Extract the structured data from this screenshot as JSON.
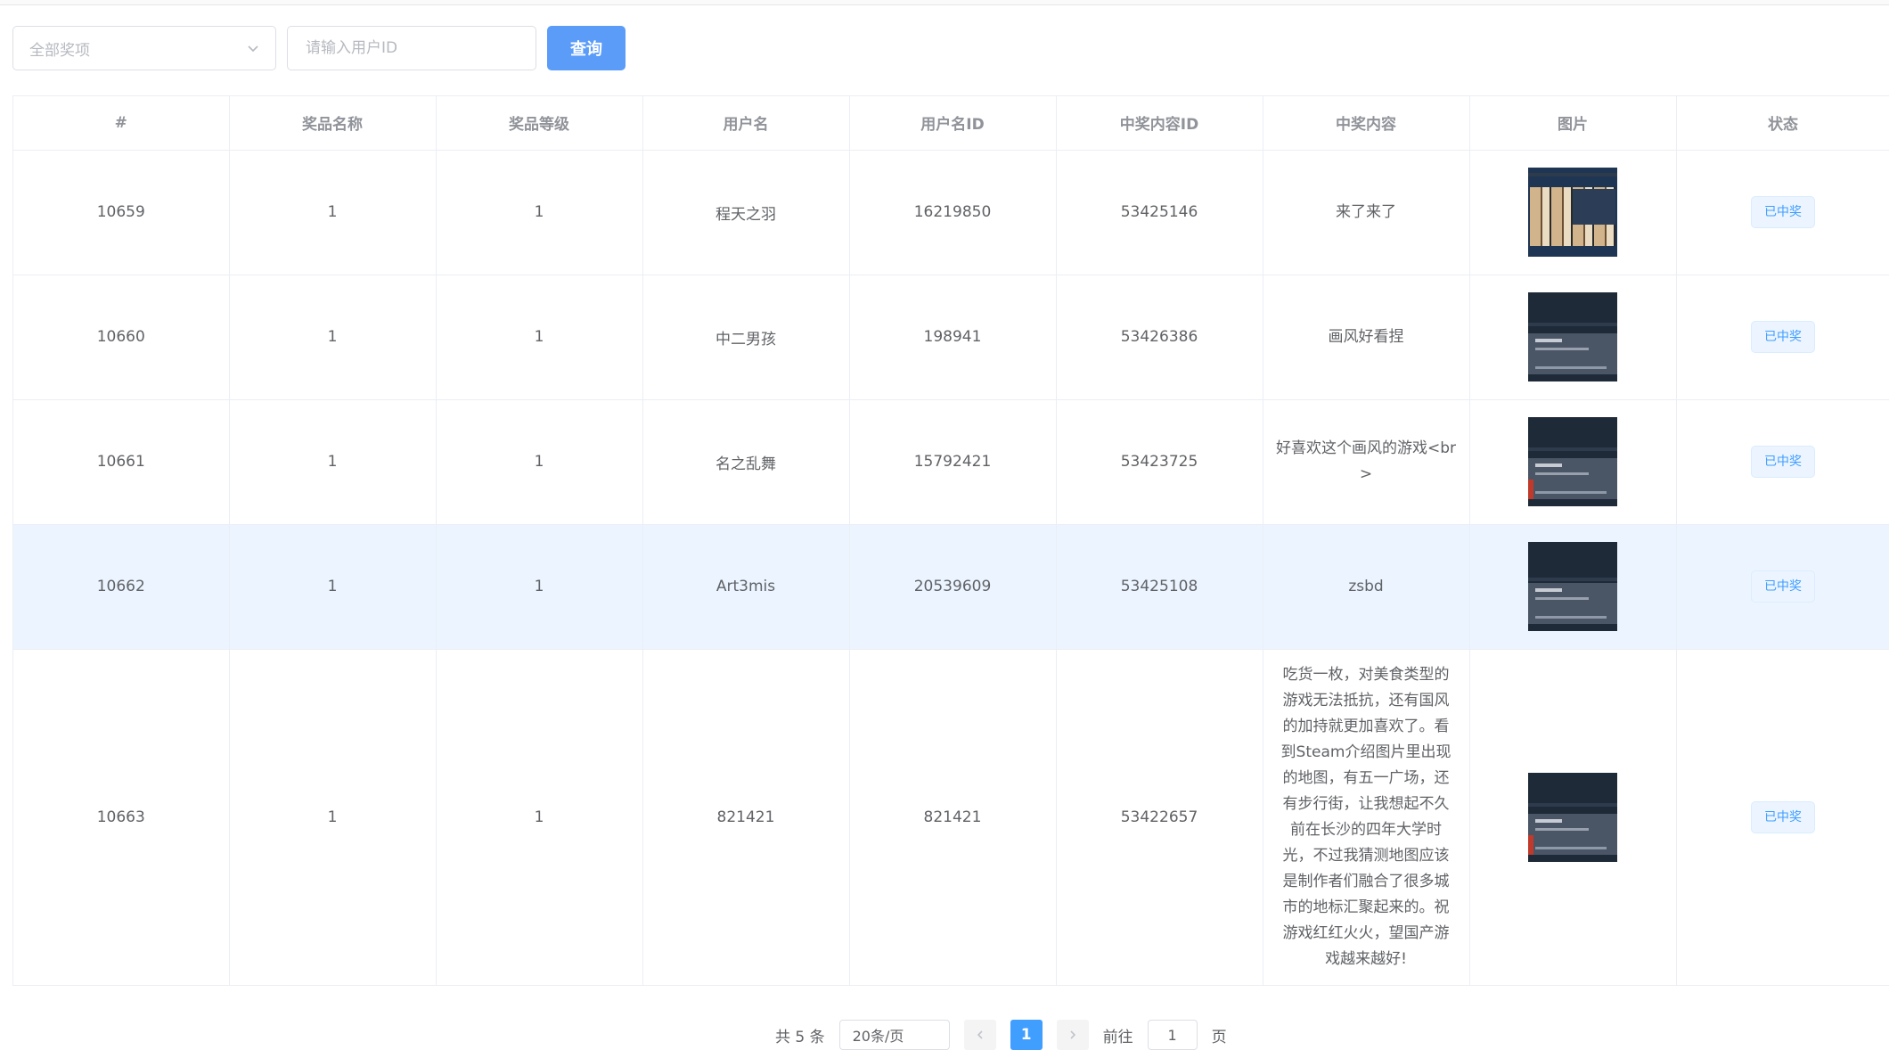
{
  "filters": {
    "prize_select_value": "全部奖项",
    "user_id_placeholder": "请输入用户ID",
    "query_button": "查询"
  },
  "table": {
    "headers": [
      "#",
      "奖品名称",
      "奖品等级",
      "用户名",
      "用户名ID",
      "中奖内容ID",
      "中奖内容",
      "图片",
      "状态"
    ],
    "rows": [
      {
        "id": "10659",
        "prize_name": "1",
        "prize_level": "1",
        "username": "程天之羽",
        "user_id": "16219850",
        "content_id": "53425146",
        "content": "来了来了",
        "status": "已中奖"
      },
      {
        "id": "10660",
        "prize_name": "1",
        "prize_level": "1",
        "username": "中二男孩",
        "user_id": "198941",
        "content_id": "53426386",
        "content": "画风好看捏",
        "status": "已中奖"
      },
      {
        "id": "10661",
        "prize_name": "1",
        "prize_level": "1",
        "username": "名之乱舞",
        "user_id": "15792421",
        "content_id": "53423725",
        "content": "好喜欢这个画风的游戏<br>",
        "status": "已中奖"
      },
      {
        "id": "10662",
        "prize_name": "1",
        "prize_level": "1",
        "username": "Art3mis",
        "user_id": "20539609",
        "content_id": "53425108",
        "content": "zsbd",
        "status": "已中奖"
      },
      {
        "id": "10663",
        "prize_name": "1",
        "prize_level": "1",
        "username": "821421",
        "user_id": "821421",
        "content_id": "53422657",
        "content": "吃货一枚，对美食类型的游戏无法抵抗，还有国风的加持就更加喜欢了。看到Steam介绍图片里出现的地图，有五一广场，还有步行街，让我想起不久前在长沙的四年大学时光，不过我猜测地图应该是制作者们融合了很多城市的地标汇聚起来的。祝游戏红红火火，望国产游戏越来越好!",
        "status": "已中奖"
      }
    ]
  },
  "pagination": {
    "total": "共 5 条",
    "page_size": "20条/页",
    "current_page": "1",
    "goto_label": "前往",
    "goto_value": "1",
    "page_suffix": "页"
  },
  "icons": {
    "select_arrow": "chevron-down-icon",
    "prev": "chevron-left-icon",
    "next": "chevron-right-icon"
  },
  "colors": {
    "primary": "#409eff",
    "primary_button": "#5a9cf8",
    "highlight_row": "#ecf5ff"
  }
}
